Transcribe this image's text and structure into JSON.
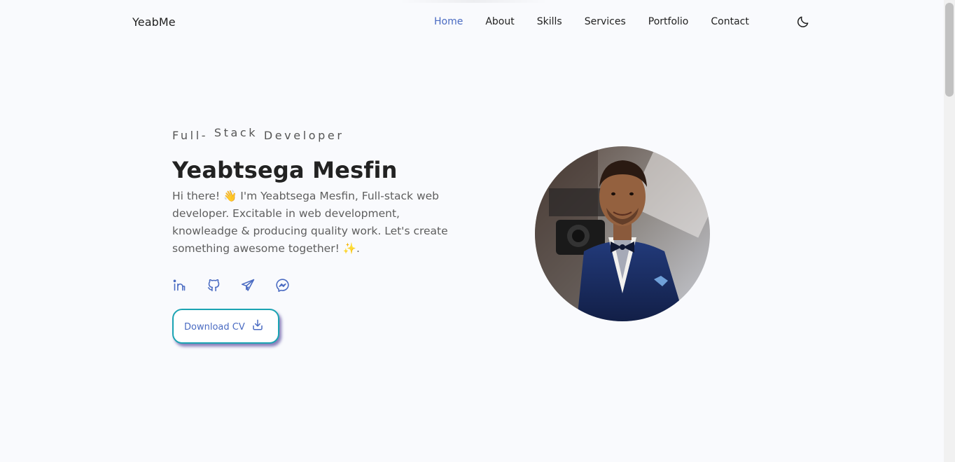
{
  "header": {
    "logo": "YeabMe",
    "nav": [
      {
        "label": "Home",
        "active": true
      },
      {
        "label": "About",
        "active": false
      },
      {
        "label": "Skills",
        "active": false
      },
      {
        "label": "Services",
        "active": false
      },
      {
        "label": "Portfolio",
        "active": false
      },
      {
        "label": "Contact",
        "active": false
      }
    ],
    "theme_icon": "moon-icon"
  },
  "hero": {
    "subtitle_parts": [
      "Full-",
      "Stack",
      "Developer"
    ],
    "name": "Yeabtsega Mesfin",
    "bio": "Hi there! 👋 I'm Yeabtsega Mesfin, Full-stack web developer. Excitable in web development, knowleadge & producing quality work. Let's create something awesome together! ✨.",
    "socials": [
      {
        "icon": "linkedin-icon"
      },
      {
        "icon": "github-icon"
      },
      {
        "icon": "telegram-icon"
      },
      {
        "icon": "messenger-icon"
      }
    ],
    "download_label": "Download CV",
    "download_icon": "download-icon"
  },
  "colors": {
    "accent": "#4a6bc2",
    "button_border": "#1ba4b3",
    "background": "#f9fafd",
    "text": "#1f1f1f",
    "muted": "#5e5e5e"
  }
}
